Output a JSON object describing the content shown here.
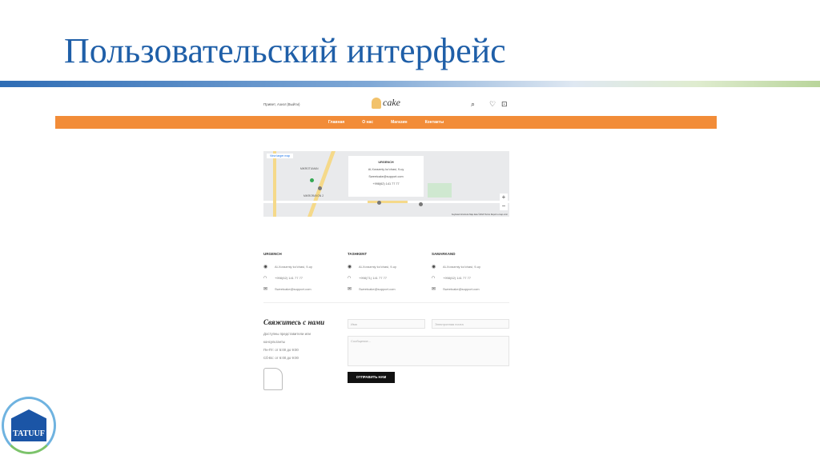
{
  "slide": {
    "title": "Пользовательский интерфейс",
    "logo_text": "TATUUF"
  },
  "site": {
    "greeting": "Привет, Азиз! (Выйти)",
    "brand": "cake",
    "icons": [
      "search-icon",
      "heart-icon",
      "bag-icon"
    ],
    "nav": [
      "Главная",
      "О нас",
      "Магазин",
      "Контакты"
    ],
    "accent": "#f28c38",
    "map": {
      "view_larger": "View larger map",
      "popup": {
        "city": "URGENCH",
        "address": "Al-Xorazmiy ko'chasi, 9-uy",
        "email": "Sweetcake@support.com",
        "phone": "+998(62) 141 77 77"
      },
      "labels": [
        "MIKROTUMAN",
        "MIKRORAYON 2"
      ],
      "footer": "Keyboard shortcuts  Map data ©2023  Terms  Report a map error"
    },
    "branches": [
      {
        "city": "URGENCH",
        "address": "Al-Xorazmiy ko'chasi, 9-uy",
        "phone": "+998(62) 141 77 77",
        "email": "Sweetcake@support.com"
      },
      {
        "city": "TASHKENT",
        "address": "Al-Xorazmiy ko'chasi, 9-uy",
        "phone": "+998(71) 141 77 77",
        "email": "Sweetcake@support.com"
      },
      {
        "city": "SAMARKAND",
        "address": "Al-Xorazmiy ko'chasi, 9-uy",
        "phone": "+998(62) 141 77 77",
        "email": "Sweetcake@support.com"
      }
    ],
    "contact": {
      "title": "Свяжитесь с нами",
      "info": [
        "Доступны представители или",
        "консультанты",
        "Пн-Пт: от 5:00 до 9:00",
        "Сб-Вс: от 6:00 до 9:00"
      ],
      "name_ph": "Имя",
      "email_ph": "Электронная почта",
      "message_ph": "Сообщение...",
      "send": "ОТПРАВИТЬ НАМ"
    }
  }
}
